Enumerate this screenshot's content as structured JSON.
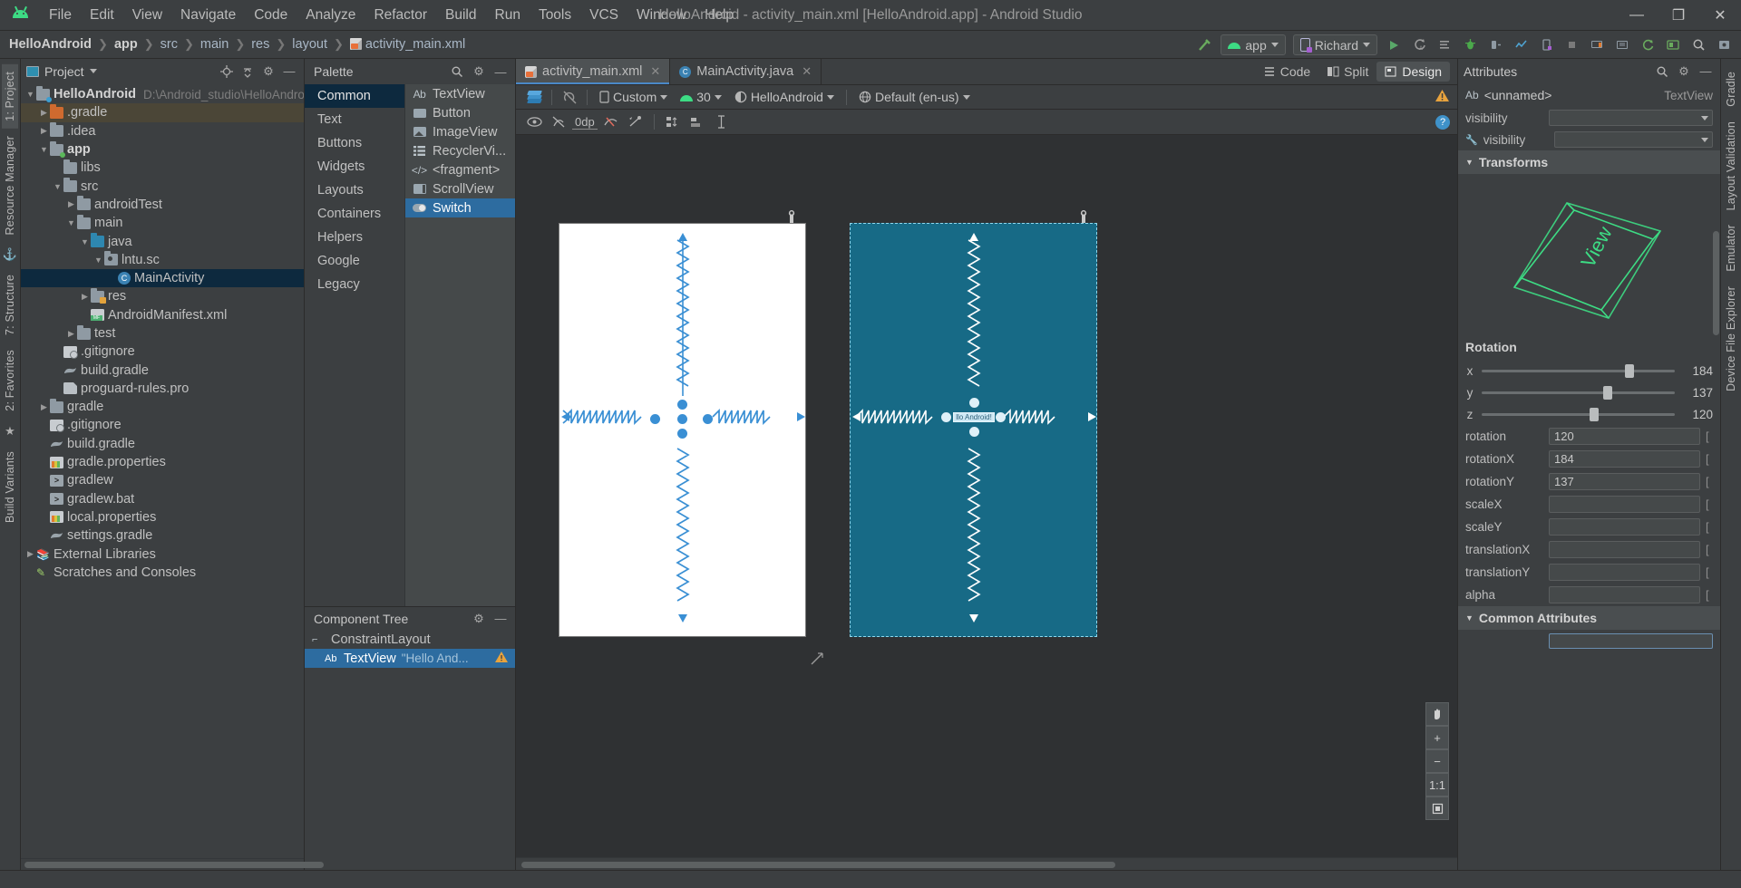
{
  "window": {
    "title": "HelloAndroid - activity_main.xml [HelloAndroid.app] - Android Studio",
    "minimize": "—",
    "maximize": "❐",
    "close": "✕"
  },
  "menu": [
    "File",
    "Edit",
    "View",
    "Navigate",
    "Code",
    "Analyze",
    "Refactor",
    "Build",
    "Run",
    "Tools",
    "VCS",
    "Window",
    "Help"
  ],
  "breadcrumbs": [
    {
      "label": "HelloAndroid",
      "bold": true
    },
    {
      "label": "app",
      "bold": true
    },
    {
      "label": "src",
      "bold": false
    },
    {
      "label": "main",
      "bold": false
    },
    {
      "label": "res",
      "bold": false
    },
    {
      "label": "layout",
      "bold": false
    },
    {
      "label": "activity_main.xml",
      "bold": false,
      "icon": "xml-file-icon"
    }
  ],
  "toolbar": {
    "build_variant_label": "app",
    "device_label": "Richard",
    "icons": [
      "build-hammer-icon",
      "run-icon",
      "apply-changes-icon",
      "apply-code-changes-icon",
      "debug-icon",
      "attach-debugger-icon",
      "profiler-icon",
      "device-manager-icon",
      "stop-icon",
      "avd-manager-icon",
      "sdk-manager-icon",
      "sync-gradle-icon",
      "layout-inspector-icon",
      "search-icon",
      "settings-icon"
    ]
  },
  "left_strip": [
    "1: Project",
    "Resource Manager",
    "7: Structure",
    "2: Favorites"
  ],
  "right_strip": [
    "Gradle",
    "Layout Validation",
    "Emulator",
    "Device File Explorer",
    "Build Variants"
  ],
  "project_panel": {
    "title": "Project",
    "actions": [
      "locate-icon",
      "collapse-all-icon",
      "settings-icon",
      "hide-icon"
    ],
    "tree": [
      {
        "label": "HelloAndroid",
        "path": "D:\\Android_studio\\HelloAndroi",
        "depth": 0,
        "arrow": "down",
        "icon": "project-folder-icon",
        "bold": true
      },
      {
        "label": ".gradle",
        "depth": 1,
        "arrow": "right",
        "icon": "orange-folder-icon",
        "highlight": true
      },
      {
        "label": ".idea",
        "depth": 1,
        "arrow": "right",
        "icon": "folder-icon"
      },
      {
        "label": "app",
        "depth": 1,
        "arrow": "down",
        "icon": "module-folder-icon",
        "bold": true
      },
      {
        "label": "libs",
        "depth": 2,
        "arrow": "none",
        "icon": "folder-icon"
      },
      {
        "label": "src",
        "depth": 2,
        "arrow": "down",
        "icon": "folder-icon"
      },
      {
        "label": "androidTest",
        "depth": 3,
        "arrow": "right",
        "icon": "folder-icon"
      },
      {
        "label": "main",
        "depth": 3,
        "arrow": "down",
        "icon": "folder-icon"
      },
      {
        "label": "java",
        "depth": 4,
        "arrow": "down",
        "icon": "source-folder-icon"
      },
      {
        "label": "lntu.sc",
        "depth": 5,
        "arrow": "down",
        "icon": "package-folder-icon"
      },
      {
        "label": "MainActivity",
        "depth": 6,
        "arrow": "none",
        "icon": "java-class-icon",
        "selected": true
      },
      {
        "label": "res",
        "depth": 4,
        "arrow": "right",
        "icon": "res-folder-icon"
      },
      {
        "label": "AndroidManifest.xml",
        "depth": 4,
        "arrow": "none",
        "icon": "manifest-file-icon"
      },
      {
        "label": "test",
        "depth": 3,
        "arrow": "right",
        "icon": "folder-icon"
      },
      {
        "label": ".gitignore",
        "depth": 2,
        "arrow": "none",
        "icon": "gitignore-file-icon"
      },
      {
        "label": "build.gradle",
        "depth": 2,
        "arrow": "none",
        "icon": "gradle-file-icon"
      },
      {
        "label": "proguard-rules.pro",
        "depth": 2,
        "arrow": "none",
        "icon": "text-file-icon"
      },
      {
        "label": "gradle",
        "depth": 1,
        "arrow": "right",
        "icon": "folder-icon"
      },
      {
        "label": ".gitignore",
        "depth": 1,
        "arrow": "none",
        "icon": "gitignore-file-icon"
      },
      {
        "label": "build.gradle",
        "depth": 1,
        "arrow": "none",
        "icon": "gradle-file-icon"
      },
      {
        "label": "gradle.properties",
        "depth": 1,
        "arrow": "none",
        "icon": "properties-file-icon"
      },
      {
        "label": "gradlew",
        "depth": 1,
        "arrow": "none",
        "icon": "script-file-icon"
      },
      {
        "label": "gradlew.bat",
        "depth": 1,
        "arrow": "none",
        "icon": "bat-file-icon"
      },
      {
        "label": "local.properties",
        "depth": 1,
        "arrow": "none",
        "icon": "properties-file-icon"
      },
      {
        "label": "settings.gradle",
        "depth": 1,
        "arrow": "none",
        "icon": "gradle-file-icon"
      },
      {
        "label": "External Libraries",
        "depth": 0,
        "arrow": "right",
        "icon": "library-icon"
      },
      {
        "label": "Scratches and Consoles",
        "depth": 0,
        "arrow": "none",
        "icon": "scratches-icon"
      }
    ]
  },
  "palette": {
    "title": "Palette",
    "actions": [
      "search-icon",
      "settings-icon",
      "hide-icon"
    ],
    "categories": [
      {
        "label": "Common",
        "selected": true
      },
      {
        "label": "Text"
      },
      {
        "label": "Buttons"
      },
      {
        "label": "Widgets"
      },
      {
        "label": "Layouts"
      },
      {
        "label": "Containers"
      },
      {
        "label": "Helpers"
      },
      {
        "label": "Google"
      },
      {
        "label": "Legacy"
      }
    ],
    "items": [
      {
        "label": "TextView",
        "icon": "text-view-icon"
      },
      {
        "label": "Button",
        "icon": "button-icon"
      },
      {
        "label": "ImageView",
        "icon": "image-view-icon"
      },
      {
        "label": "RecyclerVi...",
        "icon": "recycler-view-icon"
      },
      {
        "label": "<fragment>",
        "icon": "fragment-icon"
      },
      {
        "label": "ScrollView",
        "icon": "scroll-view-icon"
      },
      {
        "label": "Switch",
        "icon": "switch-icon",
        "selected": true
      }
    ]
  },
  "component_tree": {
    "title": "Component Tree",
    "actions": [
      "settings-icon",
      "hide-icon"
    ],
    "rows": [
      {
        "label": "ConstraintLayout",
        "sub": "",
        "depth": 0,
        "icon": "constraint-layout-icon",
        "warn": false
      },
      {
        "label": "TextView",
        "sub": "\"Hello And...",
        "depth": 1,
        "icon": "text-view-icon",
        "warn": true,
        "selected": true
      }
    ]
  },
  "editor": {
    "tabs": [
      {
        "label": "activity_main.xml",
        "icon": "xml-file-icon",
        "active": true,
        "close": "✕"
      },
      {
        "label": "MainActivity.java",
        "icon": "java-class-icon",
        "active": false,
        "close": "✕"
      }
    ],
    "modes": [
      {
        "label": "Code",
        "icon": "code-mode-icon",
        "selected": false
      },
      {
        "label": "Split",
        "icon": "split-mode-icon",
        "selected": false
      },
      {
        "label": "Design",
        "icon": "design-mode-icon",
        "selected": true
      }
    ]
  },
  "design_toolbar": {
    "view_mode_icon": "design-blueprint-layers-icon",
    "orientation_icon": "no-rotate-icon",
    "device": "Custom",
    "api_level": "30",
    "theme": "HelloAndroid",
    "locale": "Default (en-us)",
    "warning_icon": "warning-icon",
    "row2_icons": [
      "eye-visibility-icon",
      "hide-constraints-icon",
      "margin-icon",
      "clear-constraints-icon",
      "infer-constraints-icon",
      "pack-icon",
      "align-icon",
      "guidelines-icon"
    ],
    "margin_value": "0dp",
    "help_icon": "help-icon"
  },
  "canvas": {
    "design_label_icon": "wrench-icon",
    "blueprint_label_icon": "wrench-icon",
    "widget_text": "llo Android!",
    "buttons": [
      {
        "label": "pan-hand-icon"
      },
      {
        "label": "zoom-in-icon"
      },
      {
        "label": "zoom-out-icon"
      },
      {
        "label": "1:1"
      },
      {
        "label": "zoom-to-fit-icon"
      }
    ]
  },
  "attributes": {
    "title": "Attributes",
    "actions": [
      "search-icon",
      "settings-icon",
      "hide-icon"
    ],
    "element_tag": "Ab",
    "element_name": "<unnamed>",
    "element_type": "TextView",
    "top_rows": [
      {
        "key": "visibility",
        "icon": "",
        "value": ""
      },
      {
        "key": "visibility",
        "icon": "wrench-icon",
        "value": ""
      }
    ],
    "transforms_section": "Transforms",
    "transform_preview_label": "View",
    "rotation_title": "Rotation",
    "sliders": [
      {
        "axis": "x",
        "value": "184",
        "pct": 74
      },
      {
        "axis": "y",
        "value": "137",
        "pct": 63
      },
      {
        "axis": "z",
        "value": "120",
        "pct": 56
      }
    ],
    "fields": [
      {
        "key": "rotation",
        "value": "120"
      },
      {
        "key": "rotationX",
        "value": "184"
      },
      {
        "key": "rotationY",
        "value": "137"
      },
      {
        "key": "scaleX",
        "value": ""
      },
      {
        "key": "scaleY",
        "value": ""
      },
      {
        "key": "translationX",
        "value": ""
      },
      {
        "key": "translationY",
        "value": ""
      },
      {
        "key": "alpha",
        "value": ""
      }
    ],
    "common_section": "Common Attributes"
  }
}
